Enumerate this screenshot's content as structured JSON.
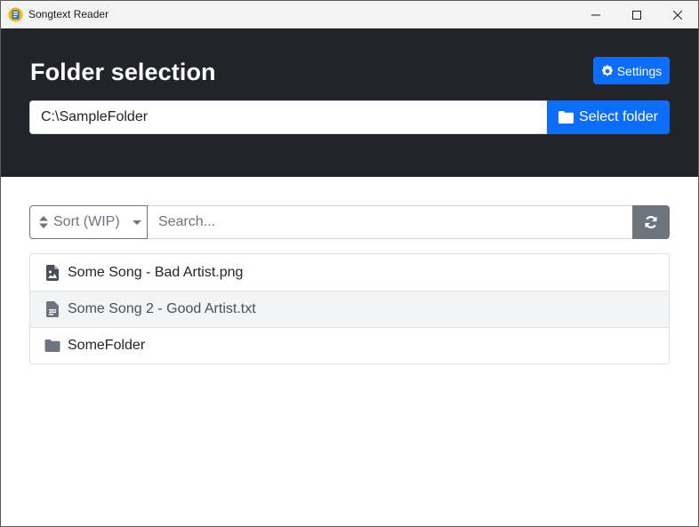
{
  "window": {
    "title": "Songtext Reader"
  },
  "header": {
    "title": "Folder selection",
    "settings_label": "Settings",
    "folder_path": "C:\\SampleFolder",
    "select_folder_label": "Select folder"
  },
  "toolbar": {
    "sort_label": "Sort (WIP)",
    "search_placeholder": "Search..."
  },
  "files": [
    {
      "name": "Some Song - Bad Artist.png",
      "icon": "image-file-icon"
    },
    {
      "name": "Some Song 2 - Good Artist.txt",
      "icon": "text-file-icon"
    },
    {
      "name": "SomeFolder",
      "icon": "folder-icon"
    }
  ],
  "colors": {
    "header_bg": "#212529",
    "primary": "#0d6efd",
    "secondary": "#6c757d"
  }
}
